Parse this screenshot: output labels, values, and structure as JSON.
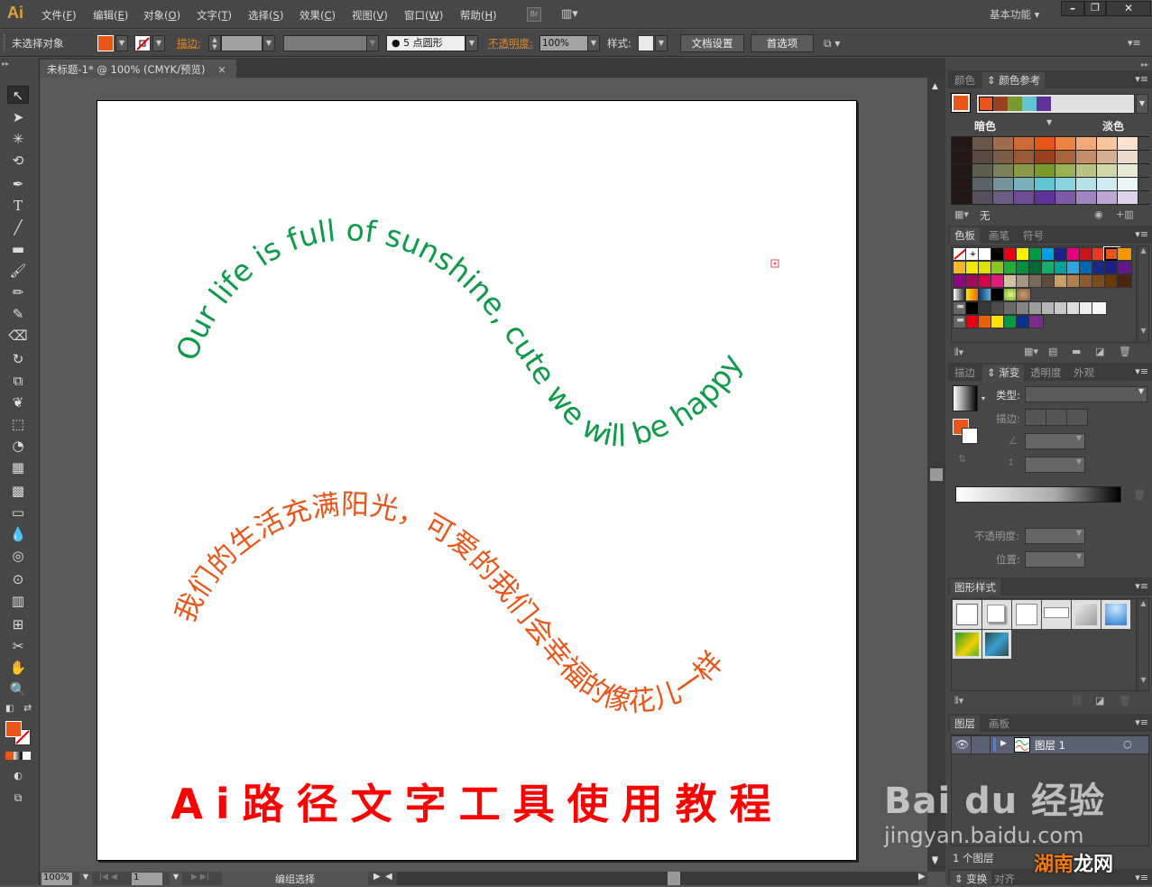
{
  "app": {
    "logo": "Ai",
    "workspace": "基本功能"
  },
  "menu": [
    {
      "label": "文件(",
      "key": "F",
      "end": ")"
    },
    {
      "label": "编辑(",
      "key": "E",
      "end": ")"
    },
    {
      "label": "对象(",
      "key": "O",
      "end": ")"
    },
    {
      "label": "文字(",
      "key": "T",
      "end": ")"
    },
    {
      "label": "选择(",
      "key": "S",
      "end": ")"
    },
    {
      "label": "效果(",
      "key": "C",
      "end": ")"
    },
    {
      "label": "视图(",
      "key": "V",
      "end": ")"
    },
    {
      "label": "窗口(",
      "key": "W",
      "end": ")"
    },
    {
      "label": "帮助(",
      "key": "H",
      "end": ")"
    }
  ],
  "bridge_label": "Br",
  "window_controls": {
    "minimize": "–",
    "restore": "❐",
    "close": "✕"
  },
  "options_bar": {
    "selection_status": "未选择对象",
    "fill_color": "#e8561a",
    "stroke_label": "描边:",
    "brush_value": "5 点圆形",
    "opacity_label": "不透明度:",
    "opacity_value": "100%",
    "style_label": "样式:",
    "doc_setup_button": "文档设置",
    "preferences_button": "首选项"
  },
  "document_tab": {
    "title": "未标题-1* @ 100% (CMYK/预览)",
    "close": "×"
  },
  "artwork": {
    "english_path_text": "Our life is full of sunshine, cute we will be happy",
    "english_color": "#0e9a4a",
    "chinese_path_text": "我们的生活充满阳光，可爱的我们会幸福的像花儿一样",
    "chinese_color": "#e8561a",
    "title": "Ai路径文字工具使用教程",
    "title_color": "#ff0000"
  },
  "status_bar": {
    "zoom": "100%",
    "artboard_number": "1",
    "status_text": "编组选择"
  },
  "color_guide_panel": {
    "tabs": [
      "颜色",
      "颜色参考"
    ],
    "active_tab": "颜色参考",
    "base_color": "#e8561a",
    "harmony_colors": [
      "#e8561a",
      "#984220",
      "#7a9a30",
      "#62c4d0",
      "#5e3296"
    ],
    "dark_label": "暗色",
    "light_label": "淡色",
    "none_label": "无",
    "grid": [
      [
        "#231816",
        "#6a5548",
        "#a06c4e",
        "#cc6a36",
        "#e8561a",
        "#ee8444",
        "#f4a87a",
        "#f8c49e",
        "#fce2d2"
      ],
      [
        "#231816",
        "#574a42",
        "#7a5c48",
        "#985a38",
        "#984220",
        "#a8643c",
        "#c48e6a",
        "#d6b094",
        "#ecdccc"
      ],
      [
        "#231816",
        "#5c5e4e",
        "#7a8058",
        "#8c9a48",
        "#7a9a30",
        "#9ab052",
        "#b8c282",
        "#d0d8aa",
        "#e8ead6"
      ],
      [
        "#231816",
        "#5a6466",
        "#76929a",
        "#7ab2bc",
        "#62c4d0",
        "#8ad2dc",
        "#b4e0e6",
        "#d0ecf0",
        "#eaf6f8"
      ],
      [
        "#231816",
        "#55505e",
        "#6c5e82",
        "#6c4c92",
        "#5e3296",
        "#7c5aa6",
        "#9e84c0",
        "#bca8d2",
        "#dcd4ea"
      ]
    ]
  },
  "swatches_panel": {
    "tabs": [
      "色板",
      "画笔",
      "符号"
    ],
    "active_tab": "色板",
    "rows": [
      [
        "none",
        "registration",
        "#ffffff",
        "#000000",
        "#e60012",
        "#fff100",
        "#009944",
        "#00a0e9",
        "#1d2088",
        "#e4007f",
        "#c9151e",
        "#e83828",
        "#e8561a",
        "#f39800"
      ],
      [
        "#f8b62d",
        "#f3e600",
        "#dde000",
        "#8fc31f",
        "#22ac38",
        "#009140",
        "#006934",
        "#13ae67",
        "#00a29a",
        "#2ea7e0",
        "#0068b7",
        "#172a88",
        "#1d2088",
        "#601986"
      ],
      [
        "#920783",
        "#a40b5d",
        "#d7004f",
        "#e4197e",
        "#d2c2a0",
        "#a89484",
        "#7a6a58",
        "#604c3c",
        "#c9a063",
        "#b2814a",
        "#8f5a2e",
        "#7c4a1c",
        "#6a3906",
        "#4a240e"
      ]
    ],
    "gradient_swatches": [
      "gradient-bw",
      "gradient-orange",
      "gradient-blue",
      "#000000",
      "pattern-green",
      "pattern-brown"
    ],
    "gray_group": [
      "#000000",
      "#363636",
      "#4c4c4c",
      "#6a6a6a",
      "#858585",
      "#9d9d9d",
      "#b5b5b5",
      "#c9c9c9",
      "#dcdcdc",
      "#eeeeee",
      "#f7f7f7"
    ],
    "color_group": [
      "#e60012",
      "#eb6100",
      "#ffe100",
      "#009944",
      "#0a318d",
      "#7d2b8f"
    ]
  },
  "gradient_panel": {
    "tabs": [
      "描边",
      "渐变",
      "透明度",
      "外观"
    ],
    "active_tab": "渐变",
    "type_label": "类型:",
    "stroke_label": "描边:",
    "opacity_label": "不透明度:",
    "position_label": "位置:"
  },
  "graphic_styles_panel": {
    "tabs": [
      "图形样式"
    ]
  },
  "layers_panel": {
    "tabs": [
      "图层",
      "画板"
    ],
    "active_tab": "图层",
    "layers": [
      {
        "name": "图层 1",
        "color": "#4b7bec"
      }
    ],
    "count_label": "1 个图层"
  },
  "bottom_panel": {
    "tabs": [
      "变换",
      "对齐"
    ],
    "active_tab": "变换"
  },
  "watermarks": {
    "baidu": "Bai du 经验",
    "baidu_url": "jingyan.baidu.com",
    "hunan_1": "湖南",
    "hunan_2": "龙网"
  }
}
